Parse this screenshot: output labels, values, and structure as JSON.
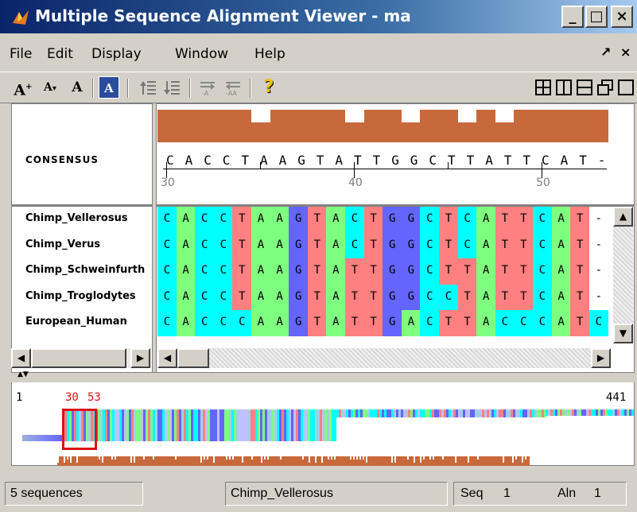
{
  "window": {
    "title": "Multiple Sequence Alignment Viewer - ma",
    "minimize_icon": "_",
    "maximize_icon": "□",
    "close_icon": "×"
  },
  "menu": {
    "items": [
      "File",
      "Edit",
      "Display",
      "Window",
      "Help"
    ],
    "undock_icon": "↗",
    "close_icon": "×"
  },
  "toolbar": {
    "font_increase": "A",
    "font_decrease": "A",
    "font_reset": "A",
    "color_toggle": "A",
    "help": "?"
  },
  "consensus": {
    "label": "CONSENSUS",
    "letters": [
      "C",
      "A",
      "C",
      "C",
      "T",
      "A",
      "A",
      "G",
      "T",
      "A",
      "T",
      "T",
      "G",
      "G",
      "C",
      "T",
      "T",
      "A",
      "T",
      "T",
      "C",
      "A",
      "T",
      "-"
    ],
    "bar_heights": [
      1,
      1,
      1,
      1,
      1,
      0.6,
      1,
      1,
      1,
      1,
      0.6,
      1,
      1,
      0.6,
      1,
      1,
      0.6,
      1,
      0.6,
      1,
      1,
      1,
      1,
      1
    ],
    "bar_color": "#c8693b"
  },
  "ruler": {
    "labels": [
      "30",
      "40",
      "50"
    ],
    "label_positions": [
      30,
      40,
      50
    ]
  },
  "alignment": {
    "sequences": [
      {
        "name": "Chimp_Vellerosus",
        "bases": "CACCTAAGTACTGGCTCATTCAT-"
      },
      {
        "name": "Chimp_Verus",
        "bases": "CACCTAAGTACTGGCTCATTCAT-"
      },
      {
        "name": "Chimp_Schweinfurth",
        "bases": "CACCTAAGTATTGGCTTATTCAT-"
      },
      {
        "name": "Chimp_Troglodytes",
        "bases": "CACCTAAGTATTGGCCTATTCAT-"
      },
      {
        "name": "European_Human",
        "bases": "CACCCAAGTATTGACTTACCCATC"
      }
    ],
    "colors": {
      "A": "#7fff7f",
      "C": "#00ffff",
      "G": "#6464ff",
      "T": "#ff8080",
      "-": "#ffffff"
    }
  },
  "overview": {
    "start_label": "1",
    "sel_start": "30",
    "sel_end": "53",
    "end_label": "441"
  },
  "status": {
    "sequences": "5 sequences",
    "selected": "Chimp_Vellerosus",
    "seq_label": "Seq",
    "seq_value": "1",
    "aln_label": "Aln",
    "aln_value": "1"
  }
}
